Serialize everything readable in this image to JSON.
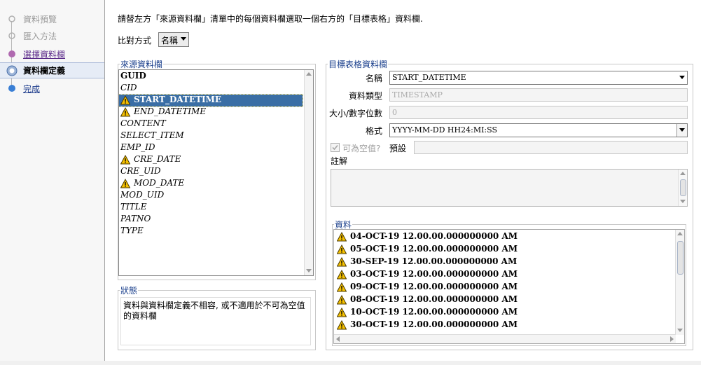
{
  "nav": {
    "steps": [
      {
        "label": "資料預覽",
        "state": "done"
      },
      {
        "label": "匯入方法",
        "state": "done"
      },
      {
        "label": "選擇資料欄",
        "state": "link"
      },
      {
        "label": "資料欄定義",
        "state": "active"
      },
      {
        "label": "完成",
        "state": "next"
      }
    ]
  },
  "main": {
    "instruction": "請替左方「來源資料欄」清單中的每個資料欄選取一個右方的「目標表格」資料欄.",
    "compare_label": "比對方式",
    "compare_value": "名稱"
  },
  "source": {
    "legend": "來源資料欄",
    "items": [
      {
        "label": "GUID",
        "style": "bold",
        "warn": false
      },
      {
        "label": "CID",
        "style": "italic",
        "warn": false
      },
      {
        "label": "START_DATETIME",
        "style": "selected",
        "warn": true
      },
      {
        "label": "END_DATETIME",
        "style": "italic",
        "warn": true
      },
      {
        "label": "CONTENT",
        "style": "italic",
        "warn": false
      },
      {
        "label": "SELECT_ITEM",
        "style": "italic",
        "warn": false
      },
      {
        "label": "EMP_ID",
        "style": "italic",
        "warn": false
      },
      {
        "label": "CRE_DATE",
        "style": "italic",
        "warn": true
      },
      {
        "label": "CRE_UID",
        "style": "italic",
        "warn": false
      },
      {
        "label": "MOD_DATE",
        "style": "italic",
        "warn": true
      },
      {
        "label": "MOD_UID",
        "style": "italic",
        "warn": false
      },
      {
        "label": "TITLE",
        "style": "italic",
        "warn": false
      },
      {
        "label": "PATNO",
        "style": "italic",
        "warn": false
      },
      {
        "label": "TYPE",
        "style": "italic",
        "warn": false
      }
    ]
  },
  "status": {
    "legend": "狀態",
    "text": "資料與資料欄定義不相容, 或不適用於不可為空值的資料欄"
  },
  "target": {
    "legend": "目標表格資料欄",
    "name_label": "名稱",
    "name_value": "START_DATETIME",
    "type_label": "資料類型",
    "type_value": "TIMESTAMP",
    "size_label": "大小/數字位數",
    "size_value": "0",
    "format_label": "格式",
    "format_value": "YYYY-MM-DD HH24:MI:SS",
    "nullable_label": "可為空值?",
    "default_label": "預設",
    "default_value": "",
    "comment_label": "註解",
    "comment_value": ""
  },
  "data": {
    "legend": "資料",
    "rows": [
      "04-OCT-19 12.00.00.000000000 AM",
      "05-OCT-19 12.00.00.000000000 AM",
      "30-SEP-19 12.00.00.000000000 AM",
      "03-OCT-19 12.00.00.000000000 AM",
      "09-OCT-19 12.00.00.000000000 AM",
      "08-OCT-19 12.00.00.000000000 AM",
      "10-OCT-19 12.00.00.000000000 AM",
      "30-OCT-19 12.00.00.000000000 AM"
    ]
  },
  "colors": {
    "selection": "#3a6ea5",
    "legend_text": "#1a3f8c",
    "warning_fill": "#f5c000"
  }
}
